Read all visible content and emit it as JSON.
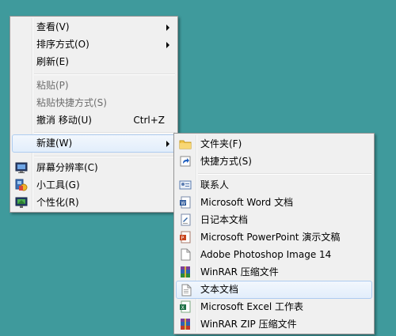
{
  "context_menu": {
    "items": [
      {
        "label": "查看(V)"
      },
      {
        "label": "排序方式(O)"
      },
      {
        "label": "刷新(E)"
      },
      {
        "label": "粘贴(P)"
      },
      {
        "label": "粘贴快捷方式(S)"
      },
      {
        "label": "撤消 移动(U)",
        "shortcut": "Ctrl+Z"
      },
      {
        "label": "新建(W)"
      },
      {
        "label": "屏幕分辨率(C)",
        "icon": "monitor-icon"
      },
      {
        "label": "小工具(G)",
        "icon": "gadgets-icon"
      },
      {
        "label": "个性化(R)",
        "icon": "personalize-icon"
      }
    ]
  },
  "new_submenu": {
    "items": [
      {
        "label": "文件夹(F)",
        "icon": "folder-icon"
      },
      {
        "label": "快捷方式(S)",
        "icon": "shortcut-icon"
      },
      {
        "label": "联系人",
        "icon": "contact-icon"
      },
      {
        "label": "Microsoft Word 文档",
        "icon": "word-doc-icon"
      },
      {
        "label": "日记本文档",
        "icon": "journal-icon"
      },
      {
        "label": "Microsoft PowerPoint 演示文稿",
        "icon": "powerpoint-icon"
      },
      {
        "label": "Adobe Photoshop Image 14",
        "icon": "photoshop-file-icon"
      },
      {
        "label": "WinRAR 压缩文件",
        "icon": "winrar-icon"
      },
      {
        "label": "文本文档",
        "icon": "text-file-icon"
      },
      {
        "label": "Microsoft Excel 工作表",
        "icon": "excel-icon"
      },
      {
        "label": "WinRAR ZIP 压缩文件",
        "icon": "winrar-zip-icon"
      }
    ]
  },
  "colors": {
    "desktop": "#3f9a9c",
    "menu_bg": "#f0f0f0",
    "highlight_border": "#aeccf0"
  }
}
